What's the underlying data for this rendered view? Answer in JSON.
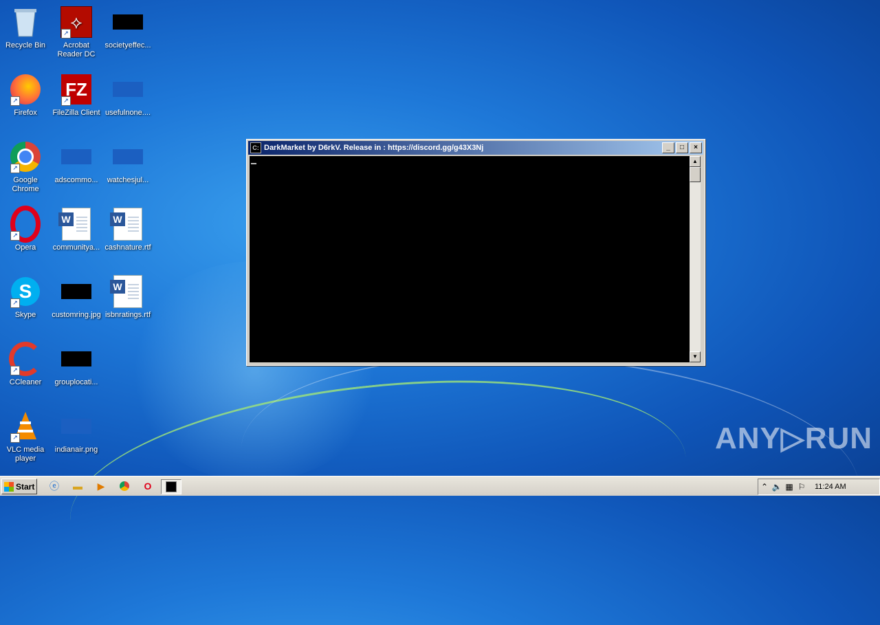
{
  "desktop_icons": [
    {
      "label": "Recycle Bin"
    },
    {
      "label": "Acrobat\nReader DC"
    },
    {
      "label": "societyeffec..."
    },
    {
      "label": "Firefox"
    },
    {
      "label": "FileZilla Client"
    },
    {
      "label": "usefulnone...."
    },
    {
      "label": "Google\nChrome"
    },
    {
      "label": "adscommo..."
    },
    {
      "label": "watchesjul..."
    },
    {
      "label": "Opera"
    },
    {
      "label": "communitya..."
    },
    {
      "label": "cashnature.rtf"
    },
    {
      "label": "Skype"
    },
    {
      "label": "customring.jpg"
    },
    {
      "label": "isbnratings.rtf"
    },
    {
      "label": "CCleaner"
    },
    {
      "label": "grouplocati..."
    },
    {
      "label": "VLC media\nplayer"
    },
    {
      "label": "indianair.png"
    }
  ],
  "window": {
    "title": "DarkMarket by D6rkV. Release in : https://discord.gg/g43X3Nj",
    "minimize": "_",
    "maximize": "□",
    "close": "×",
    "scroll_up": "▲",
    "scroll_down": "▼"
  },
  "taskbar": {
    "start_label": "Start",
    "clock": "11:24 AM"
  },
  "watermark": "ANY▷RUN",
  "icons": {
    "ie": "ie-icon",
    "explorer": "folder-icon",
    "media": "media-player-icon",
    "chrome": "chrome-icon",
    "opera": "opera-icon",
    "console": "console-icon"
  }
}
